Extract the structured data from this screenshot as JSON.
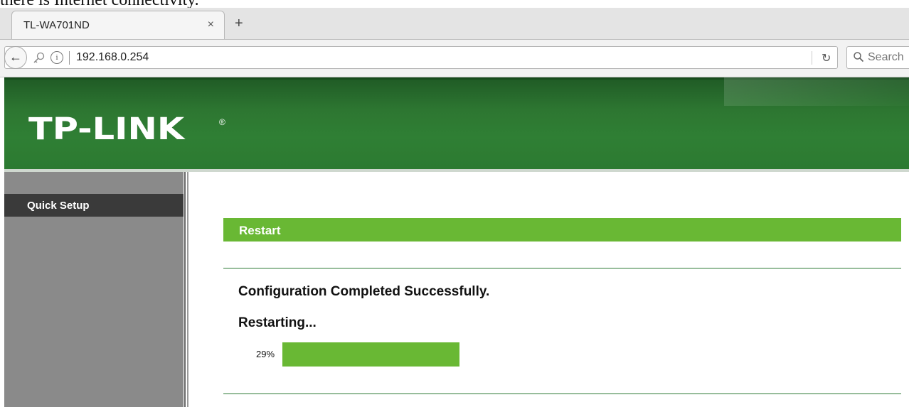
{
  "document": {
    "partial_text": "there is Internet connectivity."
  },
  "browser": {
    "tab_title": "TL-WA701ND",
    "tab_close": "×",
    "new_tab": "+",
    "url": "192.168.0.254",
    "reload": "↻",
    "search_placeholder": "Search"
  },
  "header": {
    "logo": "TP-LINK",
    "logo_mark": "®"
  },
  "sidebar": {
    "items": [
      {
        "label": "Quick Setup",
        "active": true
      }
    ]
  },
  "main": {
    "section_title": "Restart",
    "message": "Configuration Completed Successfully.",
    "status": "Restarting...",
    "progress_label": "29%",
    "progress_fraction": 0.29
  },
  "colors": {
    "accent_green": "#69b834",
    "banner_green": "#2d7631",
    "sidebar_gray": "#8a8a8a",
    "menu_active": "#3a3a3a"
  }
}
